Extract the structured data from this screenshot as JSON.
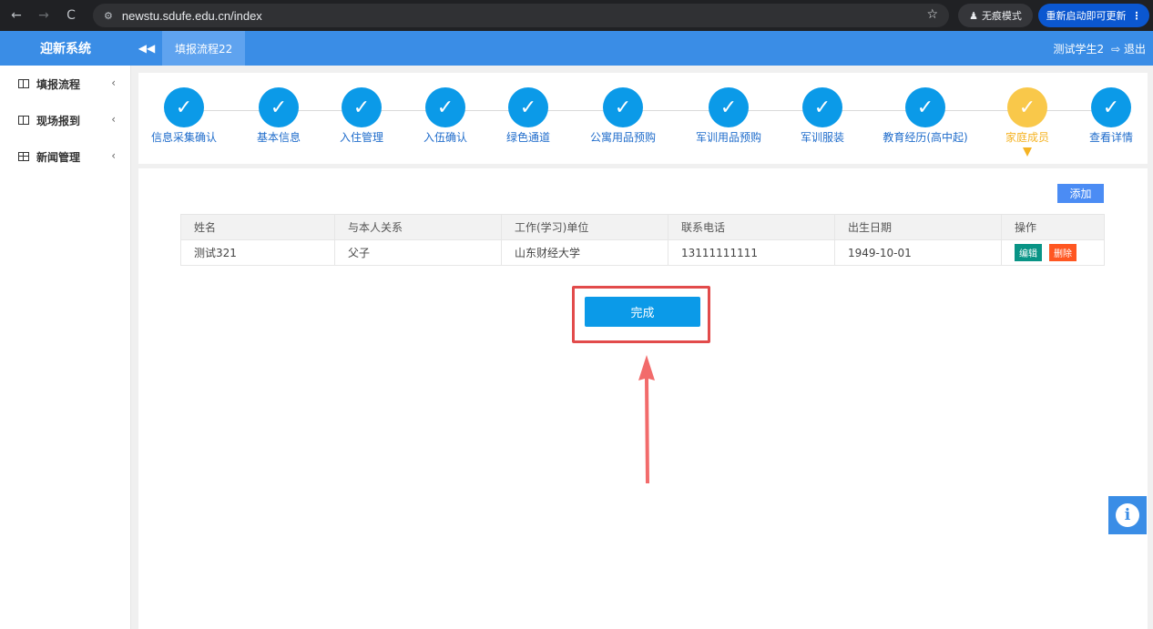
{
  "browser": {
    "back_icon": "←",
    "forward_icon": "→",
    "reload_icon": "C",
    "url": "newstu.sdufe.edu.cn/index",
    "incognito_label": "无痕模式",
    "relaunch_label": "重新启动即可更新"
  },
  "header": {
    "brand": "迎新系统",
    "tab": "填报流程22",
    "user": "测试学生2",
    "logout": "退出"
  },
  "sidebar": {
    "items": [
      {
        "label": "填报流程"
      },
      {
        "label": "现场报到"
      },
      {
        "label": "新闻管理"
      }
    ]
  },
  "steps": [
    {
      "label": "信息采集确认",
      "state": "done"
    },
    {
      "label": "基本信息",
      "state": "done"
    },
    {
      "label": "入住管理",
      "state": "done"
    },
    {
      "label": "入伍确认",
      "state": "done"
    },
    {
      "label": "绿色通道",
      "state": "done"
    },
    {
      "label": "公寓用品预购",
      "state": "done"
    },
    {
      "label": "军训用品预购",
      "state": "done"
    },
    {
      "label": "军训服装",
      "state": "done"
    },
    {
      "label": "教育经历(高中起)",
      "state": "done"
    },
    {
      "label": "家庭成员",
      "state": "active"
    },
    {
      "label": "查看详情",
      "state": "done"
    }
  ],
  "toolbar": {
    "add_label": "添加"
  },
  "table": {
    "headers": [
      "姓名",
      "与本人关系",
      "工作(学习)单位",
      "联系电话",
      "出生日期",
      "操作"
    ],
    "rows": [
      [
        "测试321",
        "父子",
        "山东财经大学",
        "13111111111",
        "1949-10-01"
      ]
    ],
    "edit_label": "编辑",
    "delete_label": "删除"
  },
  "done_label": "完成",
  "colors": {
    "primary": "#3a8de6",
    "step_done": "#0b9ae8",
    "step_active": "#f9c84a",
    "annotation_red": "#e24b4b"
  }
}
